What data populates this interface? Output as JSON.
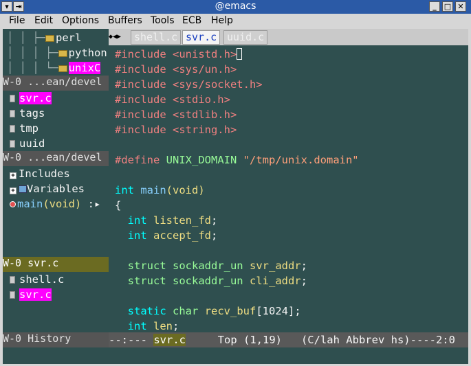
{
  "window": {
    "title": "@emacs",
    "buttons": [
      "▾",
      "⇥",
      "_",
      "□",
      "✕"
    ]
  },
  "menu": [
    "File",
    "Edit",
    "Options",
    "Buffers",
    "Tools",
    "ECB",
    "Help"
  ],
  "ecb": {
    "directories": {
      "items": [
        {
          "label": "perl",
          "guide": "│ │ ├─"
        },
        {
          "label": "python",
          "guide": "│ │ │ ├─"
        },
        {
          "label": "unixC",
          "guide": "│ │ │ └─",
          "selected": true
        }
      ],
      "separator": "W-0 ...ean/devel"
    },
    "sources": {
      "items": [
        {
          "label": "svr.c",
          "selected": true
        },
        {
          "label": "tags"
        },
        {
          "label": "tmp"
        },
        {
          "label": "uuid"
        }
      ],
      "separator": "W-0 ...ean/devel"
    },
    "methods": {
      "items": [
        {
          "label": "Includes"
        },
        {
          "label": "Variables"
        },
        {
          "name": "main",
          "args": "(void)",
          "suffix": " :▸"
        }
      ]
    },
    "history": {
      "separator": "W-0 svr.c",
      "items": [
        {
          "label": "shell.c"
        },
        {
          "label": "svr.c",
          "selected": true
        }
      ],
      "footer": "W-0 History"
    }
  },
  "tabs": [
    {
      "label": "shell.c",
      "active": false
    },
    {
      "label": "svr.c",
      "active": true
    },
    {
      "label": "uuid.c",
      "active": false
    }
  ],
  "code": {
    "includes": [
      {
        "directive": "#include",
        "arg": " <unistd.h>"
      },
      {
        "directive": "#include",
        "arg": " <sys/un.h>"
      },
      {
        "directive": "#include",
        "arg": " <sys/socket.h>"
      },
      {
        "directive": "#include",
        "arg": " <stdio.h>"
      },
      {
        "directive": "#include",
        "arg": " <stdlib.h>"
      },
      {
        "directive": "#include",
        "arg": " <string.h>"
      }
    ],
    "define": {
      "directive": "#define",
      "name": "UNIX_DOMAIN",
      "value": "\"/tmp/unix.domain\""
    },
    "main": {
      "type": "int",
      "name": "main",
      "params": "(void)",
      "open": "{"
    },
    "decls": [
      {
        "type": "int",
        "name": "listen_fd",
        "end": ";"
      },
      {
        "type": "int",
        "name": "accept_fd",
        "end": ";"
      },
      {
        "type": "struct sockaddr_un",
        "name": "svr_addr",
        "end": ";"
      },
      {
        "type": "struct sockaddr_un",
        "name": "cli_addr",
        "end": ";"
      },
      {
        "kw": "static",
        "type": "char",
        "name": "recv_buf",
        "end": "[1024];"
      },
      {
        "type": "int",
        "name": "len",
        "end": ";"
      }
    ]
  },
  "modeline": {
    "status": "--:--- ",
    "buffer": "svr.c",
    "rest": "     Top (1,19)   (C/lah Abbrev hs)----2:0"
  }
}
